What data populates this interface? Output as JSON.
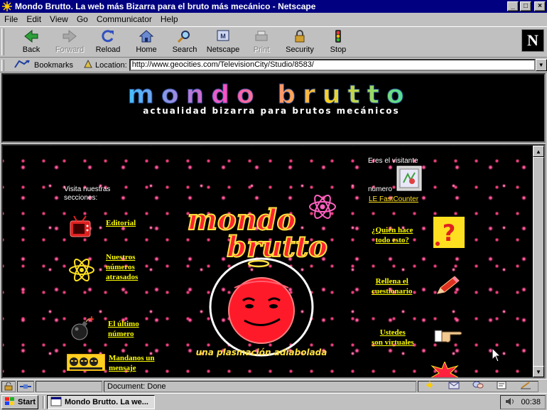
{
  "window": {
    "title": "Mondo Brutto. La web más Bizarra para el bruto más mecánico - Netscape",
    "minimize": "_",
    "maximize": "□",
    "close": "×"
  },
  "menu": [
    "File",
    "Edit",
    "View",
    "Go",
    "Communicator",
    "Help"
  ],
  "toolbar": {
    "back": "Back",
    "forward": "Forward",
    "reload": "Reload",
    "home": "Home",
    "search": "Search",
    "netscape": "Netscape",
    "print": "Print",
    "security": "Security",
    "stop": "Stop",
    "logo_letter": "N"
  },
  "location": {
    "bookmarks": "Bookmarks",
    "label": "Location:",
    "url": "http://www.geocities.com/TelevisionCity/Studio/8583/"
  },
  "banner": {
    "logo": "mondo brutto",
    "tagline": "actualidad bizarra para brutos mecánicos"
  },
  "page": {
    "visit_sections": [
      "Visita nuestras",
      "secciones:"
    ],
    "logo_line1": "mondo",
    "logo_line2": "brutto",
    "logo_tagline": "una plasmación adiabolada",
    "visitor_text": "Eres el visitante",
    "number_text": "número",
    "counter_link": "LE FastCounter",
    "links_left": [
      {
        "lines": [
          "Editorial"
        ],
        "icon": "tv-icon"
      },
      {
        "lines": [
          "Nuestros",
          "números",
          "atrasados"
        ],
        "icon": "atom-icon"
      },
      {
        "lines": [
          "El último",
          "número"
        ],
        "icon": "bomb-icon"
      },
      {
        "lines": [
          "Mandanos un",
          "mensaje"
        ],
        "icon": "faces-icon"
      }
    ],
    "links_right": [
      {
        "lines": [
          "¿Quién hace",
          "todo esto?"
        ],
        "icon": "question-icon"
      },
      {
        "lines": [
          "Rellena el",
          "cuestionario"
        ],
        "icon": "pencil-icon"
      },
      {
        "lines": [
          "Ustedes",
          "son virtuales"
        ],
        "icon": "pointing-hand-icon"
      }
    ]
  },
  "status": {
    "text": "Document: Done"
  },
  "taskbar": {
    "start": "Start",
    "task": "Mondo Brutto. La we...",
    "clock": "00:38"
  }
}
